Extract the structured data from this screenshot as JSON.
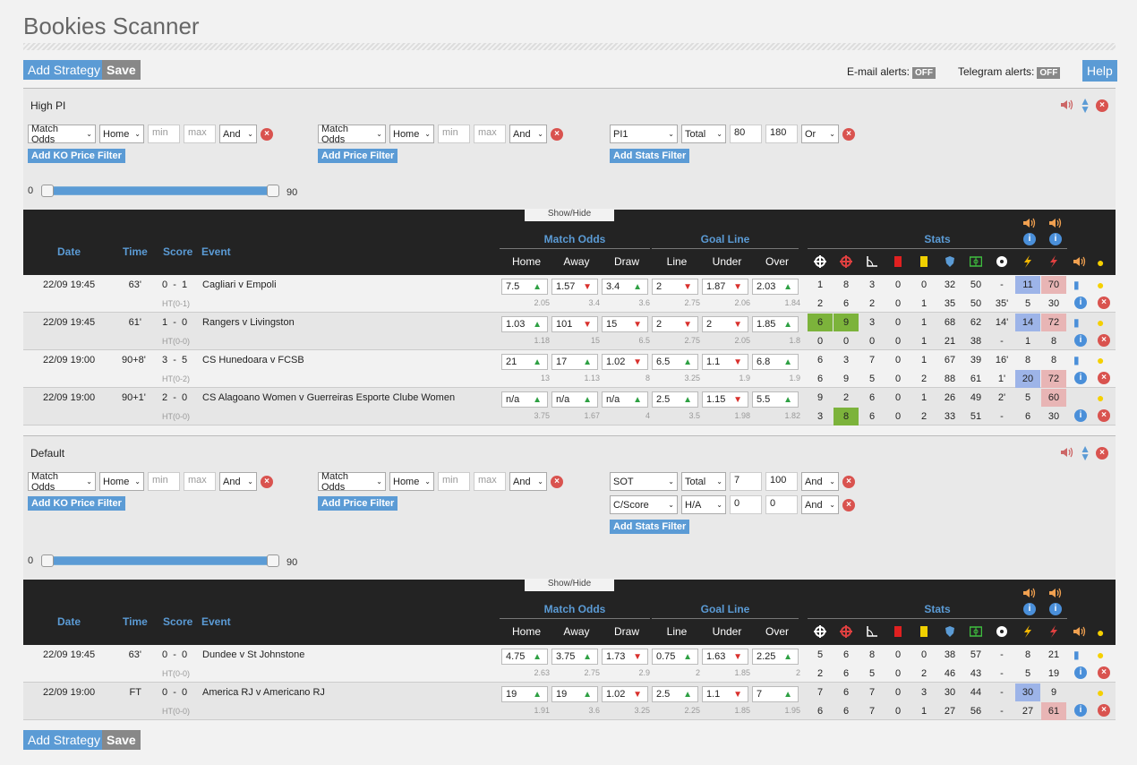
{
  "app": {
    "title": "Bookies Scanner"
  },
  "toolbar": {
    "add_strategy": "Add Strategy",
    "save": "Save",
    "email_alerts": "E-mail alerts:",
    "telegram_alerts": "Telegram alerts:",
    "off": "OFF",
    "help": "Help"
  },
  "common": {
    "show_hide": "Show/Hide",
    "add_ko": "Add KO Price Filter",
    "add_price": "Add Price Filter",
    "add_stats": "Add Stats Filter",
    "min_ph": "min",
    "max_ph": "max",
    "slider_min": "0",
    "slider_max": "90"
  },
  "table_headers": {
    "date": "Date",
    "time": "Time",
    "score": "Score",
    "event": "Event",
    "match_odds": "Match Odds",
    "goal_line": "Goal Line",
    "stats": "Stats",
    "home": "Home",
    "away": "Away",
    "draw": "Draw",
    "line": "Line",
    "under": "Under",
    "over": "Over"
  },
  "strategies": [
    {
      "name": "High PI",
      "ko_filter": {
        "market": "Match Odds",
        "side": "Home",
        "min": "",
        "max": "",
        "logic": "And"
      },
      "price_filter": {
        "market": "Match Odds",
        "side": "Home",
        "min": "",
        "max": "",
        "logic": "And"
      },
      "stats_filters": [
        {
          "stat": "PI1",
          "scope": "Total",
          "min": "80",
          "max": "180",
          "logic": "Or"
        }
      ],
      "rows": [
        {
          "date": "22/09 19:45",
          "time": "63'",
          "score": "0  -  1",
          "ht": "HT(0-1)",
          "event": "Cagliari v Empoli",
          "odds": [
            [
              "7.5",
              "up"
            ],
            [
              "1.57",
              "dn"
            ],
            [
              "3.4",
              "up"
            ],
            [
              "2",
              "dn"
            ],
            [
              "1.87",
              "dn"
            ],
            [
              "2.03",
              "up"
            ]
          ],
          "odds_sub": [
            "2.05",
            "3.4",
            "3.6",
            "2.75",
            "2.06",
            "1.84"
          ],
          "s1": [
            "1",
            "8",
            "3",
            "0",
            "0",
            "32",
            "50",
            "-",
            "11",
            "70"
          ],
          "s2": [
            "2",
            "6",
            "2",
            "0",
            "1",
            "35",
            "50",
            "35'",
            "5",
            "30"
          ],
          "hl1": {
            "8": "blue",
            "9": "red"
          },
          "hl2": {}
        },
        {
          "date": "22/09 19:45",
          "time": "61'",
          "score": "1  -  0",
          "ht": "HT(0-0)",
          "event": "Rangers v Livingston",
          "odds": [
            [
              "1.03",
              "up"
            ],
            [
              "101",
              "dn"
            ],
            [
              "15",
              "dn"
            ],
            [
              "2",
              "dn"
            ],
            [
              "2",
              "dn"
            ],
            [
              "1.85",
              "up"
            ]
          ],
          "odds_sub": [
            "1.18",
            "15",
            "6.5",
            "2.75",
            "2.05",
            "1.8"
          ],
          "s1": [
            "6",
            "9",
            "3",
            "0",
            "1",
            "68",
            "62",
            "14'",
            "14",
            "72"
          ],
          "s2": [
            "0",
            "0",
            "0",
            "0",
            "1",
            "21",
            "38",
            "-",
            "1",
            "8"
          ],
          "hl1": {
            "0": "green",
            "1": "green",
            "8": "blue",
            "9": "red"
          },
          "hl2": {}
        },
        {
          "date": "22/09 19:00",
          "time": "90+8'",
          "score": "3  -  5",
          "ht": "HT(0-2)",
          "event": "CS Hunedoara v FCSB",
          "odds": [
            [
              "21",
              "up"
            ],
            [
              "17",
              "up"
            ],
            [
              "1.02",
              "dn"
            ],
            [
              "6.5",
              "up"
            ],
            [
              "1.1",
              "dn"
            ],
            [
              "6.8",
              "up"
            ]
          ],
          "odds_sub": [
            "13",
            "1.13",
            "8",
            "3.25",
            "1.9",
            "1.9"
          ],
          "s1": [
            "6",
            "3",
            "7",
            "0",
            "1",
            "67",
            "39",
            "16'",
            "8",
            "8"
          ],
          "s2": [
            "6",
            "9",
            "5",
            "0",
            "2",
            "88",
            "61",
            "1'",
            "20",
            "72"
          ],
          "hl1": {},
          "hl2": {
            "8": "blue",
            "9": "red"
          }
        },
        {
          "date": "22/09 19:00",
          "time": "90+1'",
          "score": "2  -  0",
          "ht": "HT(0-0)",
          "event": "CS Alagoano Women v Guerreiras Esporte Clube Women",
          "odds": [
            [
              "n/a",
              "up"
            ],
            [
              "n/a",
              "up"
            ],
            [
              "n/a",
              "up"
            ],
            [
              "2.5",
              "up"
            ],
            [
              "1.15",
              "dn"
            ],
            [
              "5.5",
              "up"
            ]
          ],
          "odds_sub": [
            "3.75",
            "1.67",
            "4",
            "3.5",
            "1.98",
            "1.82"
          ],
          "s1": [
            "9",
            "2",
            "6",
            "0",
            "1",
            "26",
            "49",
            "2'",
            "5",
            "60"
          ],
          "s2": [
            "3",
            "8",
            "6",
            "0",
            "2",
            "33",
            "51",
            "-",
            "6",
            "30"
          ],
          "hl1": {
            "9": "red"
          },
          "hl2": {
            "1": "green"
          }
        }
      ]
    },
    {
      "name": "Default",
      "ko_filter": {
        "market": "Match Odds",
        "side": "Home",
        "min": "",
        "max": "",
        "logic": "And"
      },
      "price_filter": {
        "market": "Match Odds",
        "side": "Home",
        "min": "",
        "max": "",
        "logic": "And"
      },
      "stats_filters": [
        {
          "stat": "SOT",
          "scope": "Total",
          "min": "7",
          "max": "100",
          "logic": "And"
        },
        {
          "stat": "C/Score",
          "scope": "H/A",
          "min": "0",
          "max": "0",
          "logic": "And"
        }
      ],
      "rows": [
        {
          "date": "22/09 19:45",
          "time": "63'",
          "score": "0  -  0",
          "ht": "HT(0-0)",
          "event": "Dundee v St Johnstone",
          "odds": [
            [
              "4.75",
              "up"
            ],
            [
              "3.75",
              "up"
            ],
            [
              "1.73",
              "dn"
            ],
            [
              "0.75",
              "up"
            ],
            [
              "1.63",
              "dn"
            ],
            [
              "2.25",
              "up"
            ]
          ],
          "odds_sub": [
            "2.63",
            "2.75",
            "2.9",
            "2",
            "1.85",
            "2"
          ],
          "s1": [
            "5",
            "6",
            "8",
            "0",
            "0",
            "38",
            "57",
            "-",
            "8",
            "21"
          ],
          "s2": [
            "2",
            "6",
            "5",
            "0",
            "2",
            "46",
            "43",
            "-",
            "5",
            "19"
          ],
          "hl1": {},
          "hl2": {}
        },
        {
          "date": "22/09 19:00",
          "time": "FT",
          "score": "0  -  0",
          "ht": "HT(0-0)",
          "event": "America RJ v Americano RJ",
          "odds": [
            [
              "19",
              "up"
            ],
            [
              "19",
              "up"
            ],
            [
              "1.02",
              "dn"
            ],
            [
              "2.5",
              "up"
            ],
            [
              "1.1",
              "dn"
            ],
            [
              "7",
              "up"
            ]
          ],
          "odds_sub": [
            "1.91",
            "3.6",
            "3.25",
            "2.25",
            "1.85",
            "1.95"
          ],
          "s1": [
            "7",
            "6",
            "7",
            "0",
            "3",
            "30",
            "44",
            "-",
            "30",
            "9"
          ],
          "s2": [
            "6",
            "6",
            "7",
            "0",
            "1",
            "27",
            "56",
            "-",
            "27",
            "61"
          ],
          "hl1": {
            "8": "blue"
          },
          "hl2": {
            "9": "red"
          }
        }
      ]
    }
  ]
}
